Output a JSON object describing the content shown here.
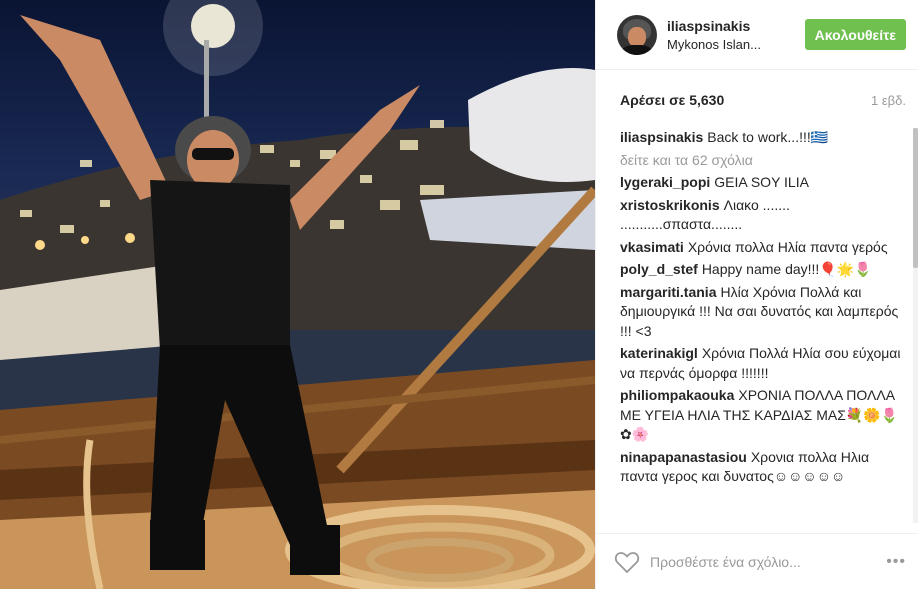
{
  "header": {
    "username": "iliaspsinakis",
    "location": "Mykonos Islan...",
    "follow_label": "Ακολουθείτε"
  },
  "likes": {
    "text": "Αρέσει σε 5,630",
    "time": "1 εβδ."
  },
  "caption": {
    "user": "iliaspsinakis",
    "text": "Back to work...!!!🇬🇷"
  },
  "view_all": "δείτε και τα 62 σχόλια",
  "comments": [
    {
      "user": "lygeraki_popi",
      "text": "GEIA SOY ILIA"
    },
    {
      "user": "xristoskrikonis",
      "text": "Λιακο ....... ...........σπαστα........"
    },
    {
      "user": "vkasimati",
      "text": "Χρόνια πολλα Ηλία παντα γερός"
    },
    {
      "user": "poly_d_stef",
      "text": "Happy name day!!!🎈🌟🌷"
    },
    {
      "user": "margariti.tania",
      "text": "Ηλία Χρόνια Πολλά και δημιουργικά !!! Να σαι δυνατός και λαμπερός !!! <3"
    },
    {
      "user": "katerinakigl",
      "text": "Χρόνια Πολλά Ηλία σου εύχομαι να περνάς όμορφα !!!!!!!"
    },
    {
      "user": "philiompakaouka",
      "text": "ΧΡΟΝΙΑ ΠΟΛΛΑ ΠΟΛΛΑ ΜΕ ΥΓΕΙΑ ΗΛΙΑ ΤΗΣ ΚΑΡΔΙΑΣ ΜΑΣ💐🌼🌷✿🌸"
    },
    {
      "user": "ninapapanastasiou",
      "text": "Χρονια πολλα Ηλια παντα γερος και δυνατος☺☺☺☺☺"
    }
  ],
  "footer": {
    "placeholder": "Προσθέστε ένα σχόλιο...",
    "more_label": "•••"
  },
  "colors": {
    "follow_button": "#70c050",
    "muted_text": "#999999"
  },
  "icons": {
    "like": "heart-icon",
    "more": "more-options-icon"
  }
}
